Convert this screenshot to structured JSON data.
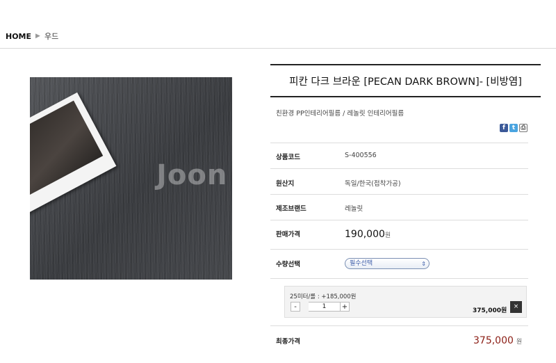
{
  "breadcrumb": {
    "home": "HOME",
    "separator": "▶",
    "current": "우드"
  },
  "image": {
    "watermark": "Joon"
  },
  "product": {
    "title": "피칸 다크 브라운 [PECAN DARK BROWN]- [비방염]",
    "category": "친환경 PP인테리어필름 / 레놀릿 인테리어필름"
  },
  "share": {
    "icons": [
      "facebook-icon",
      "twitter-icon",
      "print-icon"
    ]
  },
  "specs": {
    "code_label": "상품코드",
    "code": "S-400556",
    "origin_label": "원산지",
    "origin": "독일/한국(접착가공)",
    "brand_label": "제조브랜드",
    "brand": "레놀릿",
    "price_label": "판매가격",
    "price": "190,000",
    "price_unit": "원",
    "qty_label": "수량선택",
    "qty_select": "필수선택"
  },
  "option": {
    "name": "25미터/롤 : +185,000원",
    "minus": "-",
    "qty": "1",
    "plus": "+",
    "subtotal": "375,000원",
    "remove": "×"
  },
  "total": {
    "label": "최종가격",
    "value": "375,000",
    "unit": "원"
  },
  "colors": {
    "total": "#8b1d14",
    "select_text": "#3b5ba8"
  }
}
